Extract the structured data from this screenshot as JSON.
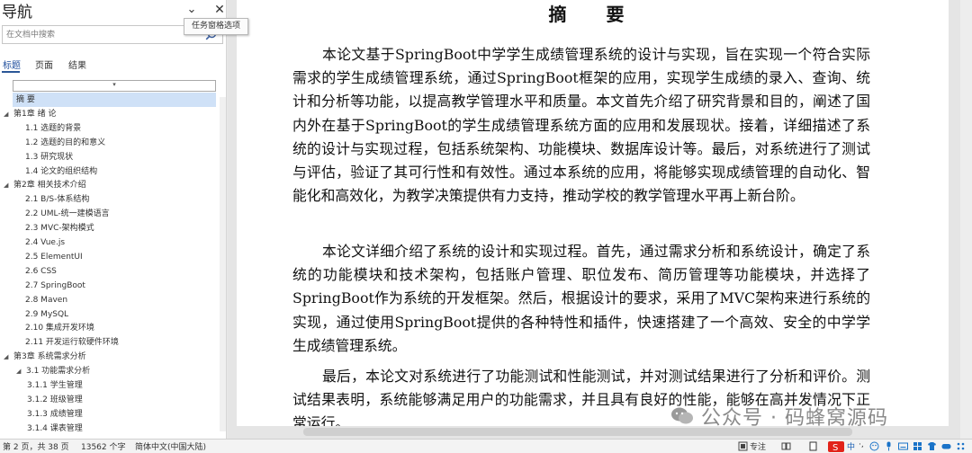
{
  "nav": {
    "title": "导航",
    "tooltip": "任务窗格选项",
    "search_placeholder": "在文档中搜索",
    "tabs": [
      "标题",
      "页面",
      "结果"
    ],
    "collapse_glyph": "▾",
    "items": [
      {
        "label": "摘  要",
        "level": 1,
        "selected": true,
        "expand": ""
      },
      {
        "label": "第1章  绪  论",
        "level": 0,
        "expand": "◢"
      },
      {
        "label": "1.1  选题的背景",
        "level": 2,
        "expand": ""
      },
      {
        "label": "1.2  选题的目的和意义",
        "level": 2,
        "expand": ""
      },
      {
        "label": "1.3  研究现状",
        "level": 2,
        "expand": ""
      },
      {
        "label": "1.4  论文的组织结构",
        "level": 2,
        "expand": ""
      },
      {
        "label": "第2章  相关技术介绍",
        "level": 0,
        "expand": "◢"
      },
      {
        "label": "2.1  B/S-体系结构",
        "level": 2,
        "expand": ""
      },
      {
        "label": "2.2  UML-统一建模语言",
        "level": 2,
        "expand": ""
      },
      {
        "label": "2.3  MVC-架构模式",
        "level": 2,
        "expand": ""
      },
      {
        "label": "2.4  Vue.js",
        "level": 2,
        "expand": ""
      },
      {
        "label": "2.5  ElementUI",
        "level": 2,
        "expand": ""
      },
      {
        "label": "2.6  CSS",
        "level": 2,
        "expand": ""
      },
      {
        "label": "2.7 SpringBoot",
        "level": 2,
        "expand": ""
      },
      {
        "label": "2.8    Maven",
        "level": 2,
        "expand": ""
      },
      {
        "label": "2.9  MySQL",
        "level": 2,
        "expand": ""
      },
      {
        "label": "2.10  集成开发环境",
        "level": 2,
        "expand": ""
      },
      {
        "label": "2.11  开发运行软硬件环境",
        "level": 2,
        "expand": ""
      },
      {
        "label": "第3章  系统需求分析",
        "level": 0,
        "expand": "◢"
      },
      {
        "label": "3.1  功能需求分析",
        "level": 1.5,
        "expand": "◢"
      },
      {
        "label": "3.1.1  学生管理",
        "level": 3,
        "expand": ""
      },
      {
        "label": "3.1.2  班级管理",
        "level": 3,
        "expand": ""
      },
      {
        "label": "3.1.3  成绩管理",
        "level": 3,
        "expand": ""
      },
      {
        "label": "3.1.4  课表管理",
        "level": 3,
        "expand": ""
      }
    ]
  },
  "document": {
    "heading": "摘要",
    "paragraphs": [
      "本论文基于SpringBoot中学学生成绩管理系统的设计与实现，旨在实现一个符合实际需求的学生成绩管理系统，通过SpringBoot框架的应用，实现学生成绩的录入、查询、统计和分析等功能，以提高教学管理水平和质量。本文首先介绍了研究背景和目的，阐述了国内外在基于SpringBoot的学生成绩管理系统方面的应用和发展现状。接着，详细描述了系统的设计与实现过程，包括系统架构、功能模块、数据库设计等。最后，对系统进行了测试与评估，验证了其可行性和有效性。通过本系统的应用，将能够实现成绩管理的自动化、智能化和高效化，为教学决策提供有力支持，推动学校的教学管理水平再上新台阶。",
      "本论文详细介绍了系统的设计和实现过程。首先，通过需求分析和系统设计，确定了系统的功能模块和技术架构，包括账户管理、职位发布、简历管理等功能模块，并选择了SpringBoot作为系统的开发框架。然后，根据设计的要求，采用了MVC架构来进行系统的实现，通过使用SpringBoot提供的各种特性和插件，快速搭建了一个高效、安全的中学学生成绩管理系统。",
      "最后，本论文对系统进行了功能测试和性能测试，并对测试结果进行了分析和评价。测试结果表明，系统能够满足用户的功能需求，并且具有良好的性能，能够在高并发情况下正常运行。"
    ],
    "watermark": "公众号 · 码蜂窝源码"
  },
  "status": {
    "page": "第 2 页，共 38 页",
    "words": "13562 个字",
    "language": "简体中文(中国大陆)",
    "focus": "专注",
    "ime": "中"
  },
  "colors": {
    "accent": "#2b5797",
    "selected": "#cfe1f7",
    "sogou": "#e2231a"
  }
}
